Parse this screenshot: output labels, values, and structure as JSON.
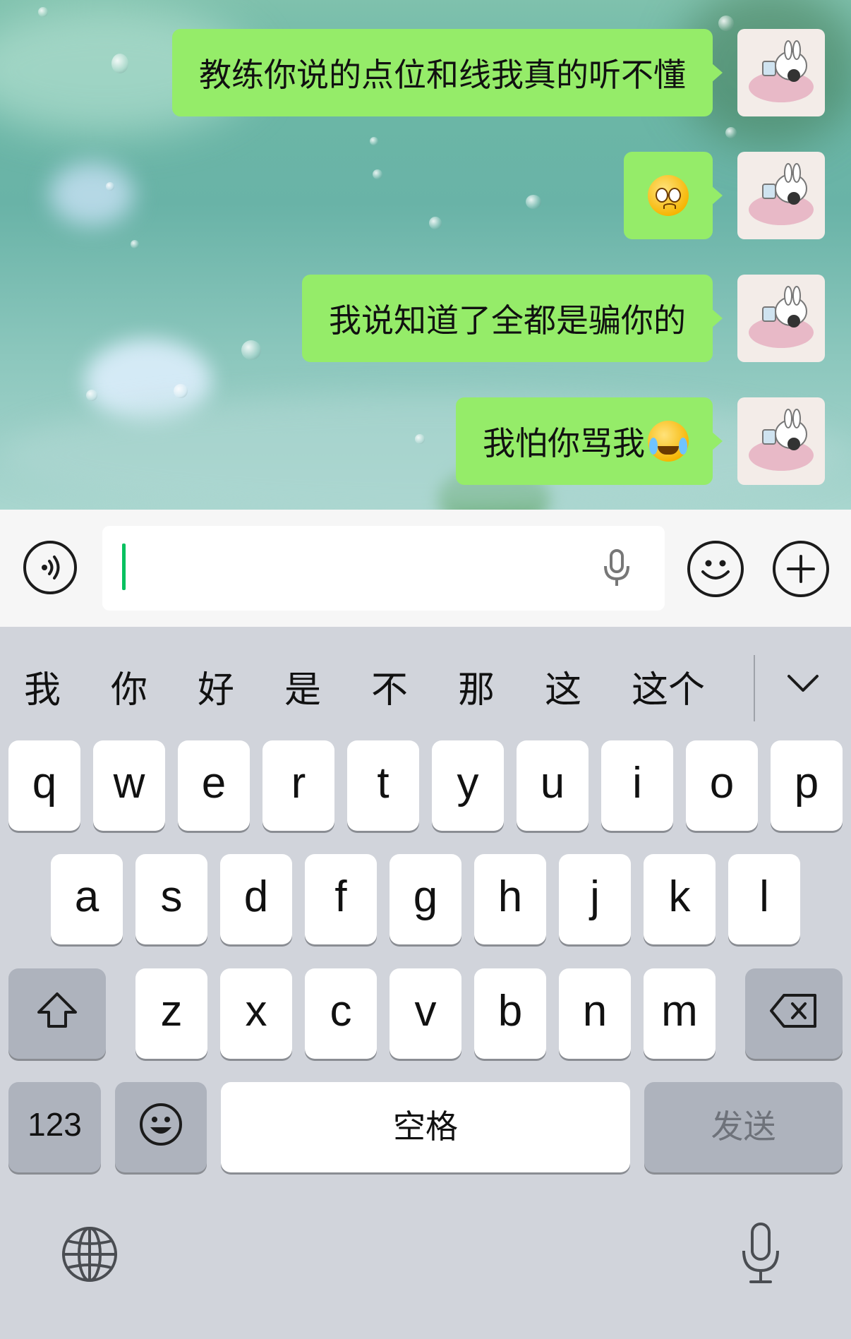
{
  "chat": {
    "messages": [
      {
        "text": "教练你说的点位和线我真的听不懂",
        "emoji": ""
      },
      {
        "text": "",
        "emoji": "flushed-face-emoji"
      },
      {
        "text": "我说知道了全都是骗你的",
        "emoji": ""
      },
      {
        "text": "我怕你骂我",
        "emoji": "tears-of-joy-emoji"
      }
    ],
    "bubble_color": "#95ec69",
    "avatar": "bunny-sticker-avatar"
  },
  "input": {
    "value": "",
    "voice_toggle_icon": "voice-icon",
    "mic_icon": "microphone-icon",
    "emoji_icon": "smiley-icon",
    "more_icon": "plus-icon",
    "caret_color": "#07c160"
  },
  "candidates": [
    "我",
    "你",
    "好",
    "是",
    "不",
    "那",
    "这",
    "这个"
  ],
  "keyboard": {
    "row1": [
      "q",
      "w",
      "e",
      "r",
      "t",
      "y",
      "u",
      "i",
      "o",
      "p"
    ],
    "row2": [
      "a",
      "s",
      "d",
      "f",
      "g",
      "h",
      "j",
      "k",
      "l"
    ],
    "row3": [
      "z",
      "x",
      "c",
      "v",
      "b",
      "n",
      "m"
    ],
    "numbers_label": "123",
    "space_label": "空格",
    "send_label": "发送"
  }
}
